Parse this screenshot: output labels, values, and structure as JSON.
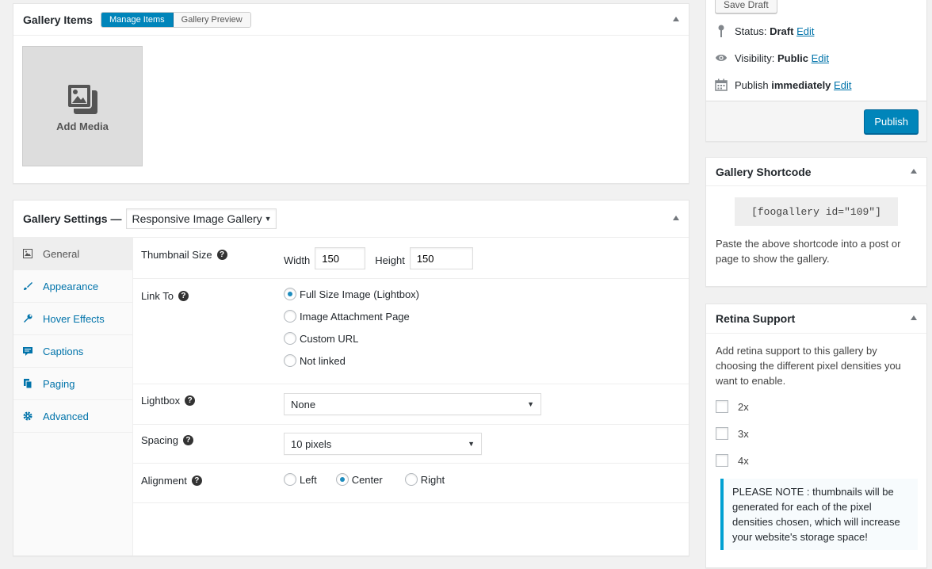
{
  "gallery_items": {
    "title": "Gallery Items",
    "tabs": [
      "Manage Items",
      "Gallery Preview"
    ],
    "add_media_label": "Add Media"
  },
  "gallery_settings": {
    "title": "Gallery Settings —",
    "template_selected": "Responsive Image Gallery",
    "tabs": [
      {
        "label": "General",
        "icon": "image-icon"
      },
      {
        "label": "Appearance",
        "icon": "brush-icon"
      },
      {
        "label": "Hover Effects",
        "icon": "wrench-icon"
      },
      {
        "label": "Captions",
        "icon": "caption-icon"
      },
      {
        "label": "Paging",
        "icon": "pages-icon"
      },
      {
        "label": "Advanced",
        "icon": "gear-icon"
      }
    ],
    "thumbnail_size": {
      "label": "Thumbnail Size",
      "width_label": "Width",
      "width_value": "150",
      "height_label": "Height",
      "height_value": "150"
    },
    "link_to": {
      "label": "Link To",
      "options": [
        "Full Size Image (Lightbox)",
        "Image Attachment Page",
        "Custom URL",
        "Not linked"
      ],
      "selected": "Full Size Image (Lightbox)"
    },
    "lightbox": {
      "label": "Lightbox",
      "value": "None"
    },
    "spacing": {
      "label": "Spacing",
      "value": "10 pixels"
    },
    "alignment": {
      "label": "Alignment",
      "options": [
        "Left",
        "Center",
        "Right"
      ],
      "selected": "Center"
    },
    "help_glyph": "?"
  },
  "publish": {
    "save_draft": "Save Draft",
    "status_label": "Status:",
    "status_value": "Draft",
    "visibility_label": "Visibility:",
    "visibility_value": "Public",
    "publish_label": "Publish",
    "publish_value": "immediately",
    "edit": "Edit",
    "publish_button": "Publish"
  },
  "shortcode": {
    "title": "Gallery Shortcode",
    "code": "[foogallery id=\"109\"]",
    "help": "Paste the above shortcode into a post or page to show the gallery."
  },
  "retina": {
    "title": "Retina Support",
    "description": "Add retina support to this gallery by choosing the different pixel densities you want to enable.",
    "options": [
      "2x",
      "3x",
      "4x"
    ],
    "note": "PLEASE NOTE : thumbnails will be generated for each of the pixel densities chosen, which will increase your website's storage space!"
  },
  "colors": {
    "primary": "#0085ba",
    "link": "#0073aa",
    "background": "#f1f1f1",
    "notice_border": "#00a0d2"
  }
}
